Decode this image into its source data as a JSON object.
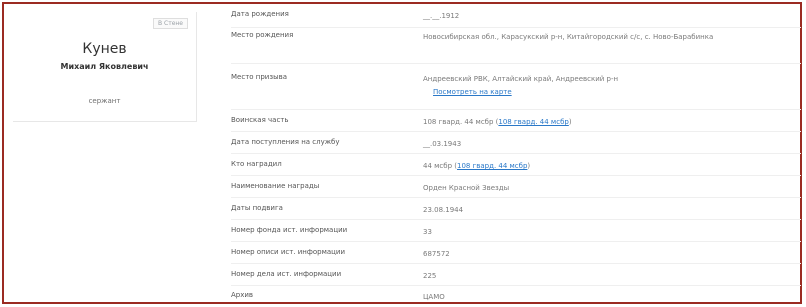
{
  "card": {
    "badge": "В Стене",
    "surname": "Кунев",
    "name": "Михаил Яковлевич",
    "rank": "сержант"
  },
  "fields": {
    "birth_date": {
      "label": "Дата рождения",
      "value": "__.__.1912"
    },
    "birth_place": {
      "label": "Место рождения",
      "value": "Новосибирская обл., Карасукский р-н, Китайгородский с/с, с. Ново-Барабинка"
    },
    "conscription_place": {
      "label": "Место призыва",
      "value": "Андреевский РВК, Алтайский край, Андреевский р-н",
      "link": "Посмотреть на карте"
    },
    "military_unit": {
      "label": "Воинская часть",
      "value_prefix": "108 гвард. 44 мсбр (",
      "link_1": "108 гвард. 44 мсбр",
      "value_suffix": ")"
    },
    "service_start": {
      "label": "Дата поступления на службу",
      "value": "__.03.1943"
    },
    "awarded_by": {
      "label": "Кто наградил",
      "value_prefix": "44 мсбр (",
      "link_1": "108 гвард. 44 мсбр",
      "value_suffix": ")"
    },
    "award_name": {
      "label": "Наименование награды",
      "value": "Орден Красной Звезды"
    },
    "feat_date": {
      "label": "Даты подвига",
      "value": "23.08.1944"
    },
    "fund_number": {
      "label": "Номер фонда ист. информации",
      "value": "33"
    },
    "inventory_number": {
      "label": "Номер описи ист. информации",
      "value": "687572"
    },
    "case_number": {
      "label": "Номер дела ист. информации",
      "value": "225"
    },
    "archive": {
      "label": "Архив",
      "value": "ЦАМО"
    }
  },
  "colors": {
    "frame_border": "#9b2b22",
    "link": "#2a78c8"
  }
}
